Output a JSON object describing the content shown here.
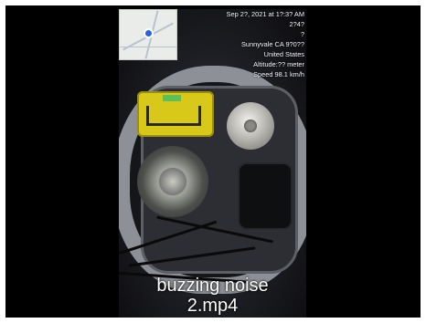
{
  "video": {
    "overlay": {
      "datetime": "Sep 2?, 2021 at 1?:3? AM",
      "line2": "2?4?",
      "line3": "?",
      "city": "Sunnyvale CA 9?0??",
      "country": "United States",
      "altitude": "Altitude:?? meter",
      "speed": "Speed 98.1 km/h"
    },
    "caption_line1": "buzzing noise",
    "caption_line2": "2.mp4"
  },
  "colors": {
    "background": "#000000",
    "caption_text": "#ffffff",
    "airbag_module": "#d8c81a"
  }
}
